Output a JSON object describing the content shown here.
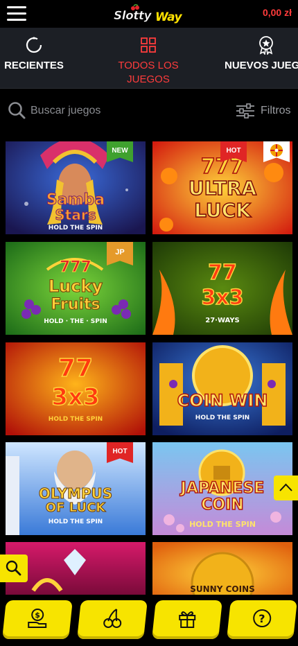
{
  "header": {
    "balance": "0,00 zł",
    "logo_text_1": "Slotty",
    "logo_text_2": "Way"
  },
  "tabs": [
    {
      "label": "RECIENTES",
      "icon": "refresh-icon",
      "active": false
    },
    {
      "label_line1": "TODOS LOS",
      "label_line2": "JUEGOS",
      "icon": "grid-icon",
      "active": true
    },
    {
      "label": "NUEVOS JUEGO",
      "icon": "badge-star-icon",
      "active": false
    }
  ],
  "search": {
    "placeholder": "Buscar juegos",
    "filter_label": "Filtros"
  },
  "games": [
    {
      "title_1": "Samba",
      "title_2": "Stars",
      "subtitle": "HOLD THE SPIN",
      "badge": "NEW"
    },
    {
      "title_1": "777",
      "title_2": "ULTRA",
      "title_3": "LUCK",
      "badge": "HOT",
      "has_wheel": true
    },
    {
      "title_1": "777",
      "title_2": "Lucky",
      "title_3": "Fruits",
      "subtitle": "HOLD · THE · SPIN",
      "badge": "JP"
    },
    {
      "title_1": "77",
      "title_2": "3x3",
      "subtitle": "27·WAYS"
    },
    {
      "title_1": "77",
      "title_2": "3x3",
      "subtitle": "HOLD THE SPIN"
    },
    {
      "title_1": "COIN WIN",
      "subtitle": "HOLD THE SPIN"
    },
    {
      "title_1": "OLYMPUS",
      "title_2": "OF LUCK",
      "subtitle": "HOLD THE SPIN",
      "badge": "HOT"
    },
    {
      "title_1": "JAPANESE",
      "title_2": "COIN",
      "subtitle": "HOLD THE SPIN"
    },
    {
      "title_1": "",
      "subtitle": ""
    },
    {
      "title_1": "SUNNY COINS",
      "subtitle": ""
    }
  ],
  "bottom_nav": [
    {
      "icon": "cash-icon"
    },
    {
      "icon": "cherries-icon"
    },
    {
      "icon": "gift-icon"
    },
    {
      "icon": "help-icon"
    }
  ],
  "colors": {
    "accent_yellow": "#f7e400",
    "accent_red": "#ff3c3c",
    "tab_bg": "#1c1f25"
  }
}
